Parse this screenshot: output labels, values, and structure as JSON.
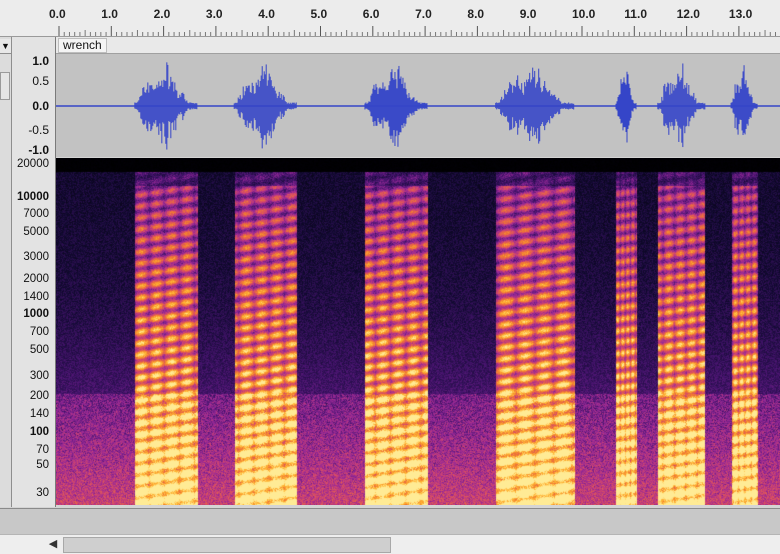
{
  "ruler": {
    "labels": [
      "0.0",
      "1.0",
      "2.0",
      "3.0",
      "4.0",
      "5.0",
      "6.0",
      "7.0",
      "8.0",
      "9.0",
      "10.0",
      "11.0",
      "12.0",
      "13.0"
    ],
    "start_seconds": 0.0,
    "end_seconds": 13.8
  },
  "track": {
    "name": "wrench",
    "menu_icon": "dropdown-triangle-icon"
  },
  "waveform_scale": [
    "1.0",
    "0.5",
    "0.0",
    "-0.5",
    "-1.0"
  ],
  "frequency_scale": [
    "20000",
    "10000",
    "7000",
    "5000",
    "3000",
    "2000",
    "1400",
    "1000",
    "700",
    "500",
    "300",
    "200",
    "140",
    "100",
    "70",
    "50",
    "30"
  ],
  "colors": {
    "waveform": "#3545c8",
    "waveform_bg": "#c2c2c2",
    "spectrogram_palette": [
      "#000000",
      "#1a1040",
      "#5a1a78",
      "#b0309a",
      "#e8603a",
      "#ffb030",
      "#ffe8a0"
    ]
  },
  "utterances_seconds": [
    [
      1.45,
      2.65
    ],
    [
      3.35,
      4.55
    ],
    [
      5.85,
      7.05
    ],
    [
      8.35,
      9.85
    ],
    [
      10.65,
      11.05
    ],
    [
      11.45,
      12.35
    ],
    [
      12.85,
      13.35
    ]
  ]
}
